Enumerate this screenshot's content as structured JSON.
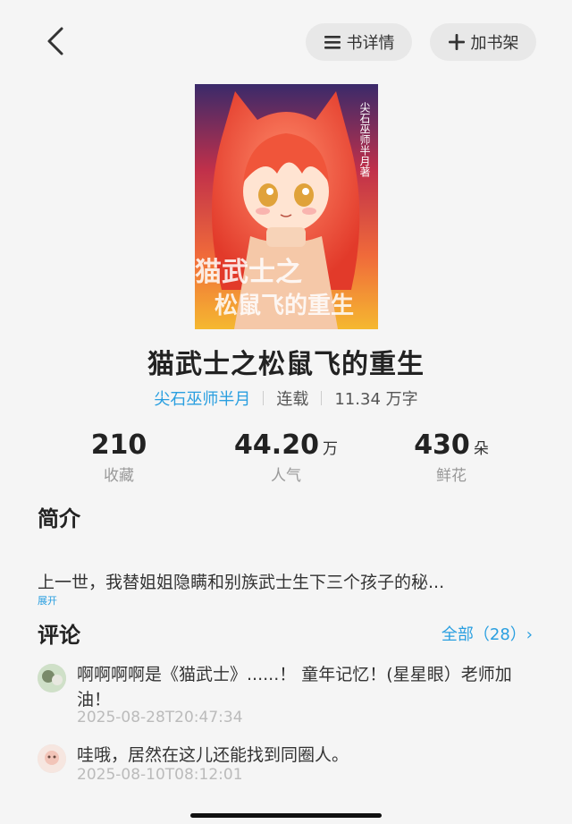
{
  "topbar": {
    "detail_label": "书详情",
    "shelf_label": "加书架"
  },
  "cover": {
    "vertical_text": "尖石巫师半月著",
    "title_line1": "猫武士之",
    "title_line2": "松鼠飞的重生"
  },
  "book": {
    "title": "猫武士之松鼠飞的重生",
    "author": "尖石巫师半月",
    "status": "连载",
    "words": "11.34 万字"
  },
  "stats": {
    "favorites": {
      "value": "210",
      "unit": "",
      "label": "收藏"
    },
    "popularity": {
      "value": "44.20",
      "unit": "万",
      "label": "人气"
    },
    "flowers": {
      "value": "430",
      "unit": "朵",
      "label": "鲜花"
    }
  },
  "intro": {
    "title": "简介",
    "text": "上一世，我替姐姐隐瞒和别族武士生下三个孩子的秘...",
    "expand": "展开"
  },
  "comments": {
    "title": "评论",
    "all_link": "全部（28）›",
    "items": [
      {
        "text": "啊啊啊啊是《猫武士》......！ 童年记忆！(星星眼）老师加油！",
        "time": "2025-08-28T20:47:34"
      },
      {
        "text": "哇哦，居然在这儿还能找到同圈人。",
        "time": "2025-08-10T08:12:01"
      }
    ]
  },
  "colors": {
    "accent": "#2a9fe0",
    "background": "#f5f5f5"
  }
}
